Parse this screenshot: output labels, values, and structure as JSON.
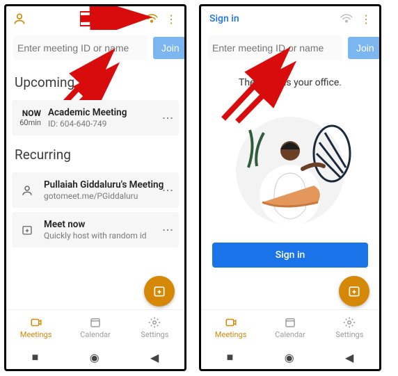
{
  "left": {
    "top": {
      "sign_in": null
    },
    "search_placeholder": "Enter meeting ID or name",
    "join_label": "Join",
    "sections": {
      "upcoming_header": "Upcoming",
      "recurring_header": "Recurring"
    },
    "upcoming": [
      {
        "when_badge": "NOW",
        "duration": "60min",
        "title": "Academic Meeting",
        "sub": "ID: 604-640-749"
      }
    ],
    "recurring": [
      {
        "icon": "person",
        "title": "Pullaiah Giddaluru's Meeting",
        "sub": "gotomeet.me/PGiddaluru"
      },
      {
        "icon": "instant",
        "title": "Meet now",
        "sub": "Quickly host with random id"
      }
    ],
    "tabs": {
      "meetings": "Meetings",
      "calendar": "Calendar",
      "settings": "Settings"
    }
  },
  "right": {
    "top_sign_in": "Sign in",
    "search_placeholder": "Enter meeting ID or name",
    "join_label": "Join",
    "hero_text": "The world is your office.",
    "signin_button": "Sign in",
    "tabs": {
      "meetings": "Meetings",
      "calendar": "Calendar",
      "settings": "Settings"
    }
  },
  "colors": {
    "accent": "#d48806",
    "primary": "#1a73e8",
    "annotation": "#d80c0c"
  }
}
